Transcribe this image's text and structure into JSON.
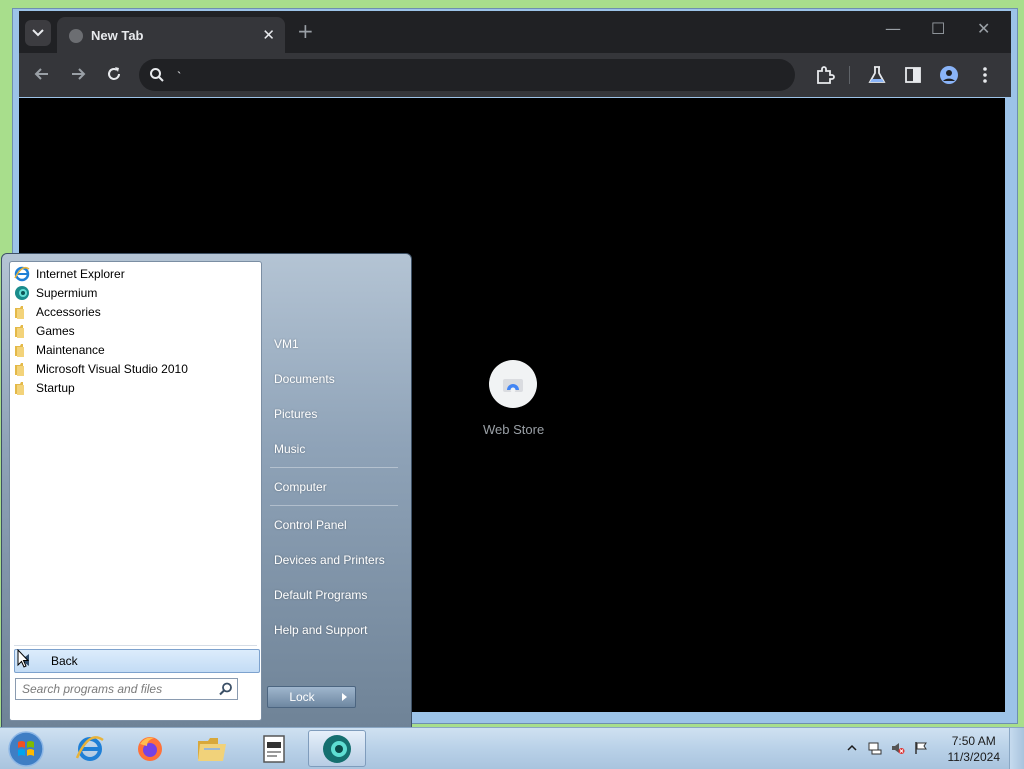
{
  "browser": {
    "tab_title": "New Tab",
    "close_glyph": "✕",
    "new_tab_glyph": "+",
    "minimize_glyph": "—",
    "maximize_glyph": "☐",
    "close_window_glyph": "✕",
    "omnibox_value": "`",
    "shortcut": {
      "label": "Web Store",
      "icon": "web-store-icon"
    }
  },
  "startmenu": {
    "programs": [
      {
        "label": "Internet Explorer",
        "icon": "internet-explorer-icon"
      },
      {
        "label": "Supermium",
        "icon": "supermium-icon"
      },
      {
        "label": "Accessories",
        "icon": "folder-icon"
      },
      {
        "label": "Games",
        "icon": "folder-icon"
      },
      {
        "label": "Maintenance",
        "icon": "folder-icon"
      },
      {
        "label": "Microsoft Visual Studio 2010",
        "icon": "folder-icon"
      },
      {
        "label": "Startup",
        "icon": "folder-icon"
      }
    ],
    "back_label": "Back",
    "search_placeholder": "Search programs and files",
    "right_items": [
      "VM1",
      "Documents",
      "Pictures",
      "Music",
      "Computer",
      "Control Panel",
      "Devices and Printers",
      "Default Programs",
      "Help and Support"
    ],
    "lock_label": "Lock"
  },
  "taskbar": {
    "time": "7:50 AM",
    "date": "11/3/2024",
    "pinned": [
      "start-orb",
      "internet-explorer",
      "firefox",
      "file-explorer",
      "notepad-document",
      "supermium"
    ]
  }
}
